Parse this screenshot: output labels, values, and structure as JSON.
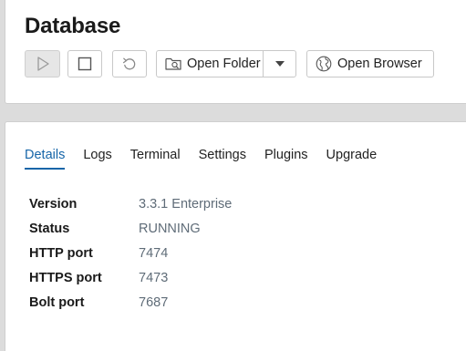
{
  "header": {
    "title": "Database"
  },
  "toolbar": {
    "start_icon": "play-icon",
    "stop_icon": "stop-icon",
    "restart_icon": "restart-icon",
    "open_folder_label": "Open Folder",
    "open_folder_icon": "folder-icon",
    "dropdown_icon": "caret-down-icon",
    "open_browser_label": "Open Browser",
    "open_browser_icon": "globe-icon"
  },
  "tabs": [
    {
      "label": "Details",
      "active": true
    },
    {
      "label": "Logs",
      "active": false
    },
    {
      "label": "Terminal",
      "active": false
    },
    {
      "label": "Settings",
      "active": false
    },
    {
      "label": "Plugins",
      "active": false
    },
    {
      "label": "Upgrade",
      "active": false
    }
  ],
  "details": [
    {
      "key": "Version",
      "value": "3.3.1 Enterprise"
    },
    {
      "key": "Status",
      "value": "RUNNING"
    },
    {
      "key": "HTTP port",
      "value": "7474"
    },
    {
      "key": "HTTPS port",
      "value": "7473"
    },
    {
      "key": "Bolt port",
      "value": "7687"
    }
  ],
  "colors": {
    "accent": "#1565a8",
    "value_text": "#5f6c78",
    "background": "#dcdcdc"
  }
}
